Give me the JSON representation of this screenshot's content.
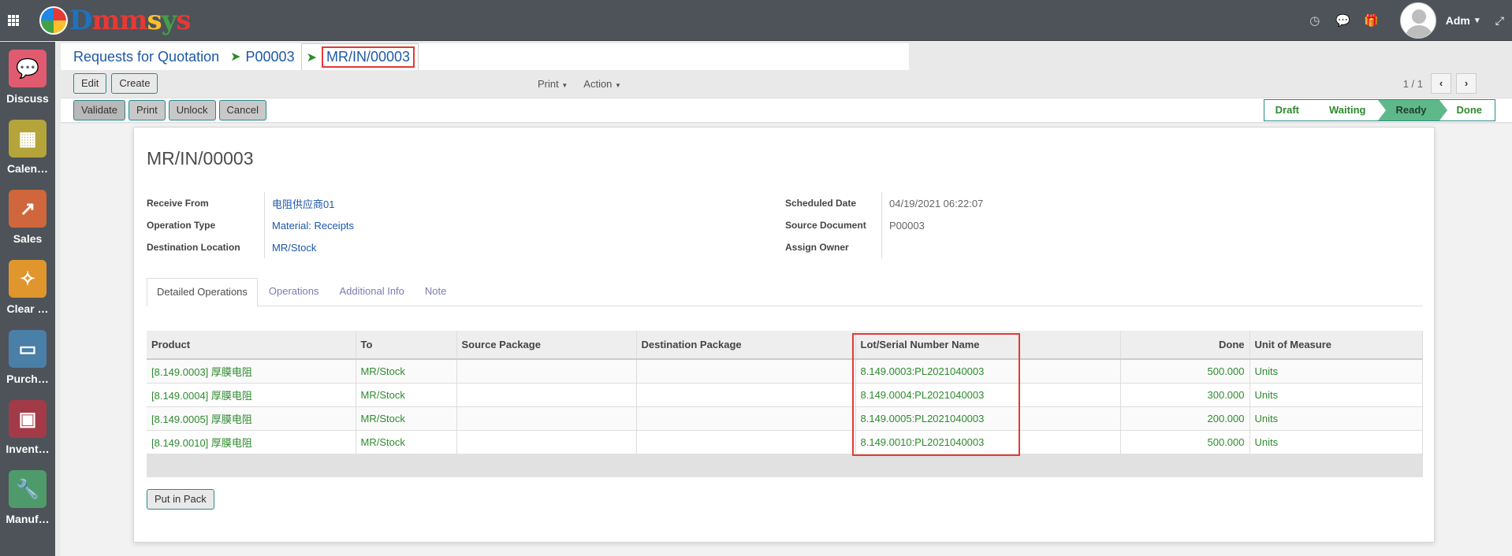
{
  "app": {
    "logo_text": "Dmmsys",
    "user": "Adm"
  },
  "topbar": {
    "icons": [
      "clock-icon",
      "chat-icon",
      "gift-icon",
      "expand-icon"
    ]
  },
  "apps": [
    {
      "label": "Discuss",
      "icon": "chat-bubble-icon",
      "color": "#e05b6f"
    },
    {
      "label": "Calen…",
      "icon": "calendar-icon",
      "color": "#b5a43a"
    },
    {
      "label": "Sales",
      "icon": "chart-up-icon",
      "color": "#d0663b"
    },
    {
      "label": "Clear …",
      "icon": "broom-icon",
      "color": "#e0962d"
    },
    {
      "label": "Purch…",
      "icon": "credit-card-icon",
      "color": "#4a7fa8"
    },
    {
      "label": "Invent…",
      "icon": "box-icon",
      "color": "#a33a48"
    },
    {
      "label": "Manuf…",
      "icon": "wrench-icon",
      "color": "#4f9a6b"
    }
  ],
  "breadcrumb": {
    "items": [
      "Requests for Quotation",
      "P00003"
    ],
    "active": "MR/IN/00003"
  },
  "toolbar": {
    "edit_label": "Edit",
    "create_label": "Create",
    "print_label": "Print",
    "action_label": "Action",
    "pager_text": "1 / 1",
    "prev_label": "‹",
    "next_label": "›"
  },
  "statusbar": {
    "buttons": [
      "Validate",
      "Print",
      "Unlock",
      "Cancel"
    ],
    "stages": [
      "Draft",
      "Waiting",
      "Ready",
      "Done"
    ],
    "current_stage": "Ready"
  },
  "form": {
    "title": "MR/IN/00003",
    "left_fields": [
      {
        "label": "Receive From",
        "value": "电阻供应商01"
      },
      {
        "label": "Operation Type",
        "value": "Material: Receipts"
      },
      {
        "label": "Destination Location",
        "value": "MR/Stock"
      }
    ],
    "right_fields": [
      {
        "label": "Scheduled Date",
        "value": "04/19/2021 06:22:07"
      },
      {
        "label": "Source Document",
        "value": "P00003"
      },
      {
        "label": "Assign Owner",
        "value": ""
      }
    ],
    "tabs": [
      "Detailed Operations",
      "Operations",
      "Additional Info",
      "Note"
    ],
    "active_tab": "Detailed Operations",
    "table": {
      "headers": [
        "Product",
        "To",
        "Source Package",
        "Destination Package",
        "Lot/Serial Number Name",
        "Done",
        "Unit of Measure"
      ],
      "rows": [
        [
          "[8.149.0003] 厚膜电阻",
          "MR/Stock",
          "",
          "",
          "8.149.0003:PL2021040003",
          "500.000",
          "Units"
        ],
        [
          "[8.149.0004] 厚膜电阻",
          "MR/Stock",
          "",
          "",
          "8.149.0004:PL2021040003",
          "300.000",
          "Units"
        ],
        [
          "[8.149.0005] 厚膜电阻",
          "MR/Stock",
          "",
          "",
          "8.149.0005:PL2021040003",
          "200.000",
          "Units"
        ],
        [
          "[8.149.0010] 厚膜电阻",
          "MR/Stock",
          "",
          "",
          "8.149.0010:PL2021040003",
          "500.000",
          "Units"
        ]
      ]
    },
    "put_in_pack_label": "Put in Pack"
  },
  "colors": {
    "topbar": "#4d5359",
    "link": "#1e58a8",
    "line_text": "#2e8b2e",
    "highlight": "#e53935",
    "stage_current": "#5fb889"
  }
}
